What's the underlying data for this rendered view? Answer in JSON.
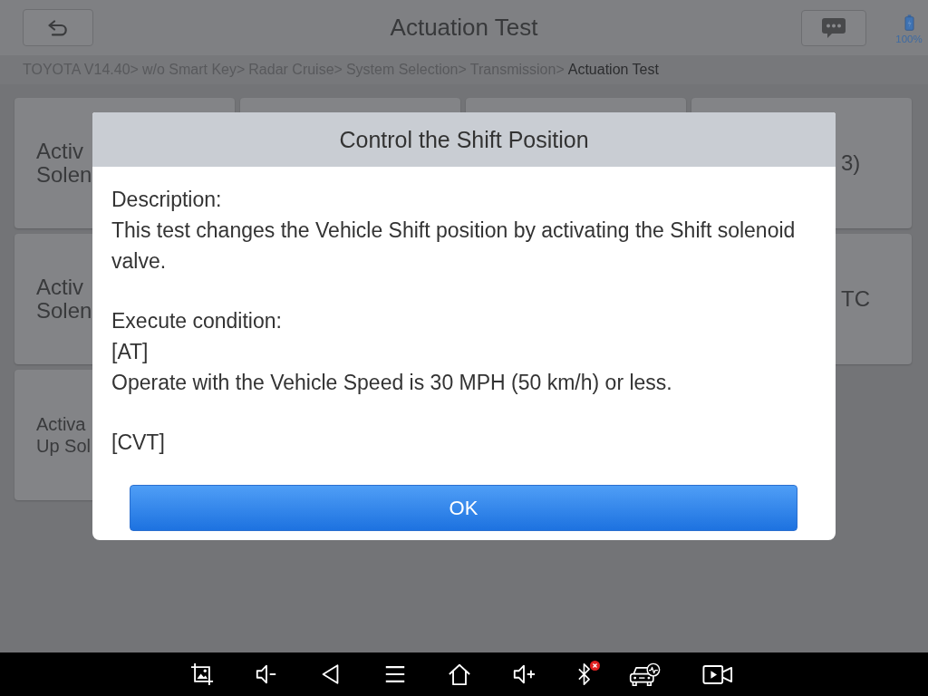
{
  "header": {
    "title": "Actuation Test"
  },
  "battery": {
    "reading": "100%"
  },
  "breadcrumb": [
    {
      "label": "TOYOTA V14.40>",
      "current": false
    },
    {
      "label": "w/o Smart Key>",
      "current": false
    },
    {
      "label": "Radar Cruise>",
      "current": false
    },
    {
      "label": "System Selection>",
      "current": false
    },
    {
      "label": "Transmission>",
      "current": false
    },
    {
      "label": "Actuation Test",
      "current": true
    }
  ],
  "tile_rows": [
    {
      "tiles": [
        {
          "kind": "label",
          "lines": [
            "Activ",
            "Solen"
          ]
        },
        {
          "kind": "blank"
        },
        {
          "kind": "blank"
        },
        {
          "kind": "label",
          "lines": [
            "3)"
          ]
        }
      ]
    },
    {
      "tiles": [
        {
          "kind": "label",
          "lines": [
            "Activ",
            "Solen"
          ]
        },
        {
          "kind": "label",
          "lines": [
            "TC"
          ]
        }
      ]
    },
    {
      "tiles": [
        {
          "kind": "small-label",
          "lines": [
            "Activa",
            "Up Sol"
          ]
        }
      ]
    }
  ],
  "dialog": {
    "title": "Control the Shift Position",
    "sections": [
      {
        "lines": [
          "Description:",
          "This test changes the Vehicle Shift position by activating the Shift solenoid valve."
        ]
      },
      {
        "lines": [
          "Execute condition:",
          "[AT]",
          "Operate with the Vehicle Speed is 30 MPH (50 km/h) or less."
        ]
      },
      {
        "lines": [
          "[CVT]"
        ]
      }
    ],
    "button": "OK"
  }
}
